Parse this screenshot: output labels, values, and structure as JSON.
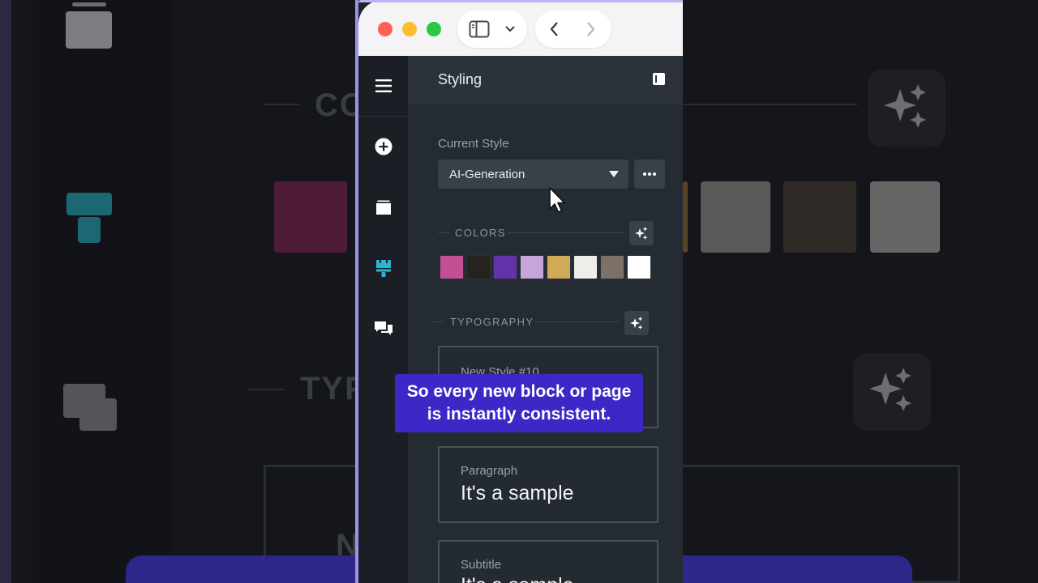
{
  "window": {
    "controls": [
      "close",
      "minimize",
      "maximize"
    ],
    "toolbar_icons": [
      "sidebar-toggle-icon",
      "chevron-down-icon",
      "back-arrow-icon",
      "forward-arrow-icon"
    ]
  },
  "sidebar": {
    "icons": [
      "menu-icon",
      "add-icon",
      "pages-icon",
      "styling-icon",
      "comments-icon"
    ],
    "active": "styling-icon",
    "active_color": "#29b5d4"
  },
  "panel": {
    "title": "Styling",
    "current_style": {
      "label": "Current Style",
      "value": "AI-Generation"
    },
    "colors": {
      "heading": "COLORS",
      "swatches": [
        "#c44f92",
        "#26221d",
        "#6432a9",
        "#c7a5dc",
        "#d1aa57",
        "#efedea",
        "#7b7169",
        "#ffffff"
      ]
    },
    "typography": {
      "heading": "TYPOGRAPHY",
      "styles": [
        {
          "label": "New Style #10",
          "sample": ""
        },
        {
          "label": "Paragraph",
          "sample": "It's a sample"
        },
        {
          "label": "Subtitle",
          "sample": "It's a sample"
        }
      ]
    }
  },
  "caption": {
    "line1": "So every new block or page",
    "line2": "is instantly consistent."
  },
  "background": {
    "text_left_top": "CO",
    "text_left_mid": "TYP",
    "text_left_bottom": "N"
  }
}
